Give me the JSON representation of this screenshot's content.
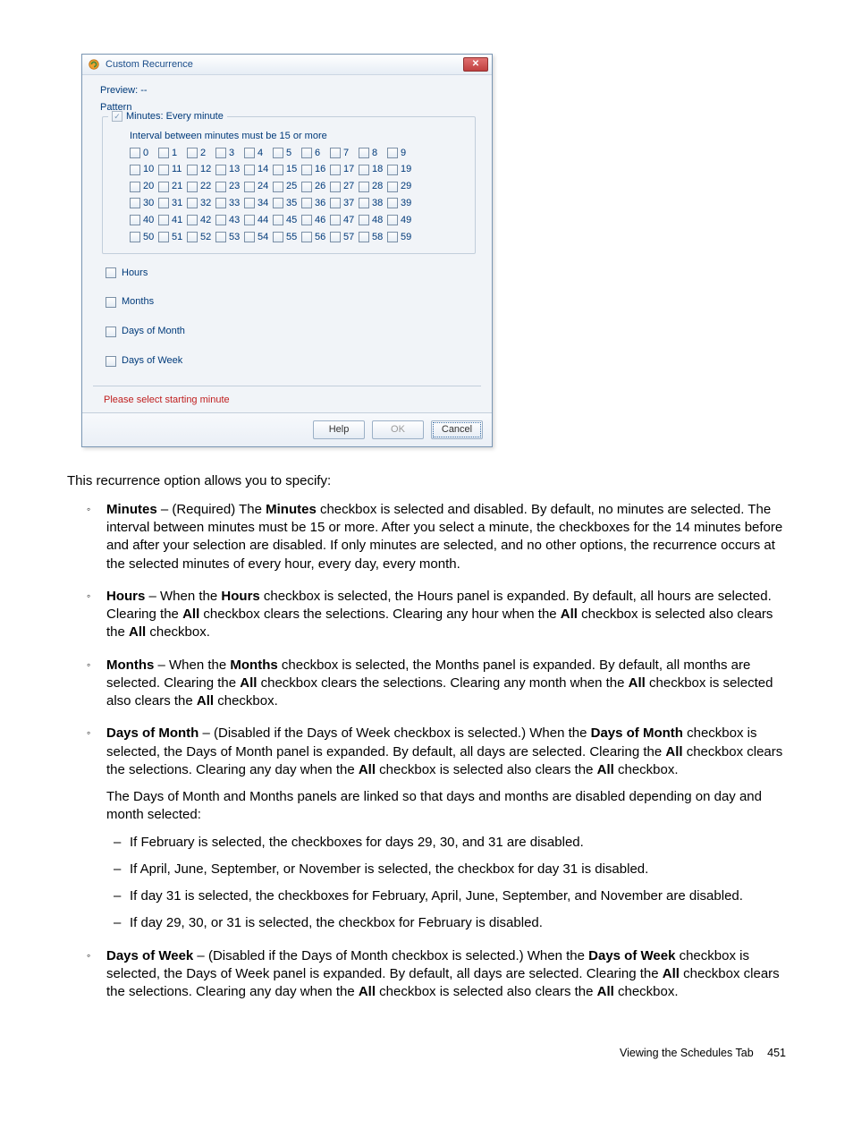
{
  "dialog": {
    "title": "Custom Recurrence",
    "preview_label": "Preview: --",
    "pattern_label": "Pattern",
    "minutes_legend": "Minutes: Every minute",
    "interval_msg": "Interval between minutes must be 15 or more",
    "minute_numbers": [
      [
        "0",
        "1",
        "2",
        "3",
        "4",
        "5",
        "6",
        "7",
        "8",
        "9"
      ],
      [
        "10",
        "11",
        "12",
        "13",
        "14",
        "15",
        "16",
        "17",
        "18",
        "19"
      ],
      [
        "20",
        "21",
        "22",
        "23",
        "24",
        "25",
        "26",
        "27",
        "28",
        "29"
      ],
      [
        "30",
        "31",
        "32",
        "33",
        "34",
        "35",
        "36",
        "37",
        "38",
        "39"
      ],
      [
        "40",
        "41",
        "42",
        "43",
        "44",
        "45",
        "46",
        "47",
        "48",
        "49"
      ],
      [
        "50",
        "51",
        "52",
        "53",
        "54",
        "55",
        "56",
        "57",
        "58",
        "59"
      ]
    ],
    "sections": {
      "hours": "Hours",
      "months": "Months",
      "days_of_month": "Days of Month",
      "days_of_week": "Days of Week"
    },
    "error": "Please select starting minute",
    "buttons": {
      "help": "Help",
      "ok": "OK",
      "cancel": "Cancel"
    }
  },
  "intro": "This recurrence option allows you to specify:",
  "opts": {
    "minutes": {
      "name": "Minutes",
      "rest1": " – (Required) The ",
      "b2": "Minutes",
      "rest2": " checkbox is selected and disabled. By default, no minutes are selected. The interval between minutes must be 15 or more. After you select a minute, the checkboxes for the 14 minutes before and after your selection are disabled. If only minutes are selected, and no other options, the recurrence occurs at the selected minutes of every hour, every day, every month."
    },
    "hours": {
      "name": "Hours",
      "rest1": " – When the ",
      "b2": "Hours",
      "rest2": " checkbox is selected, the Hours panel is expanded. By default, all hours are selected. Clearing the ",
      "b3": "All",
      "rest3": " checkbox clears the selections. Clearing any hour when the ",
      "b4": "All",
      "rest4": " checkbox is selected also clears the ",
      "b5": "All",
      "rest5": " checkbox."
    },
    "months": {
      "name": "Months",
      "rest1": " – When the ",
      "b2": "Months",
      "rest2": " checkbox is selected, the Months panel is expanded. By default, all months are selected. Clearing the ",
      "b3": "All",
      "rest3": " checkbox clears the selections. Clearing any month when the ",
      "b4": "All",
      "rest4": " checkbox is selected also clears the ",
      "b5": "All",
      "rest5": " checkbox."
    },
    "daysmonth": {
      "name": "Days of Month",
      "rest1": " – (Disabled if the Days of Week checkbox is selected.) When the ",
      "b2": "Days of Month",
      "rest2": " checkbox is selected, the Days of Month panel is expanded. By default, all days are selected. Clearing the ",
      "b3": "All",
      "rest3": " checkbox clears the selections. Clearing any day when the ",
      "b4": "All",
      "rest4": " checkbox is selected also clears the ",
      "b5": "All",
      "rest5": " checkbox.",
      "linked": "The Days of Month and Months panels are linked so that days and months are disabled depending on day and month selected:",
      "sub1": "If February is selected, the checkboxes for days 29, 30, and 31 are disabled.",
      "sub2": "If April, June, September, or November is selected, the checkbox for day 31 is disabled.",
      "sub3": "If day 31 is selected, the checkboxes for February, April, June, September, and November are disabled.",
      "sub4": "If day 29, 30, or 31 is selected, the checkbox for February is disabled."
    },
    "daysweek": {
      "name": "Days of Week",
      "rest1": " – (Disabled if the Days of Month checkbox is selected.) When the ",
      "b2": "Days of Week",
      "rest2": " checkbox is selected, the Days of Week panel is expanded. By default, all days are selected. Clearing the ",
      "b3": "All",
      "rest3": " checkbox clears the selections. Clearing any day when the ",
      "b4": "All",
      "rest4": " checkbox is selected also clears the ",
      "b5": "All",
      "rest5": " checkbox."
    }
  },
  "footer": {
    "text": "Viewing the Schedules Tab",
    "page": "451"
  }
}
